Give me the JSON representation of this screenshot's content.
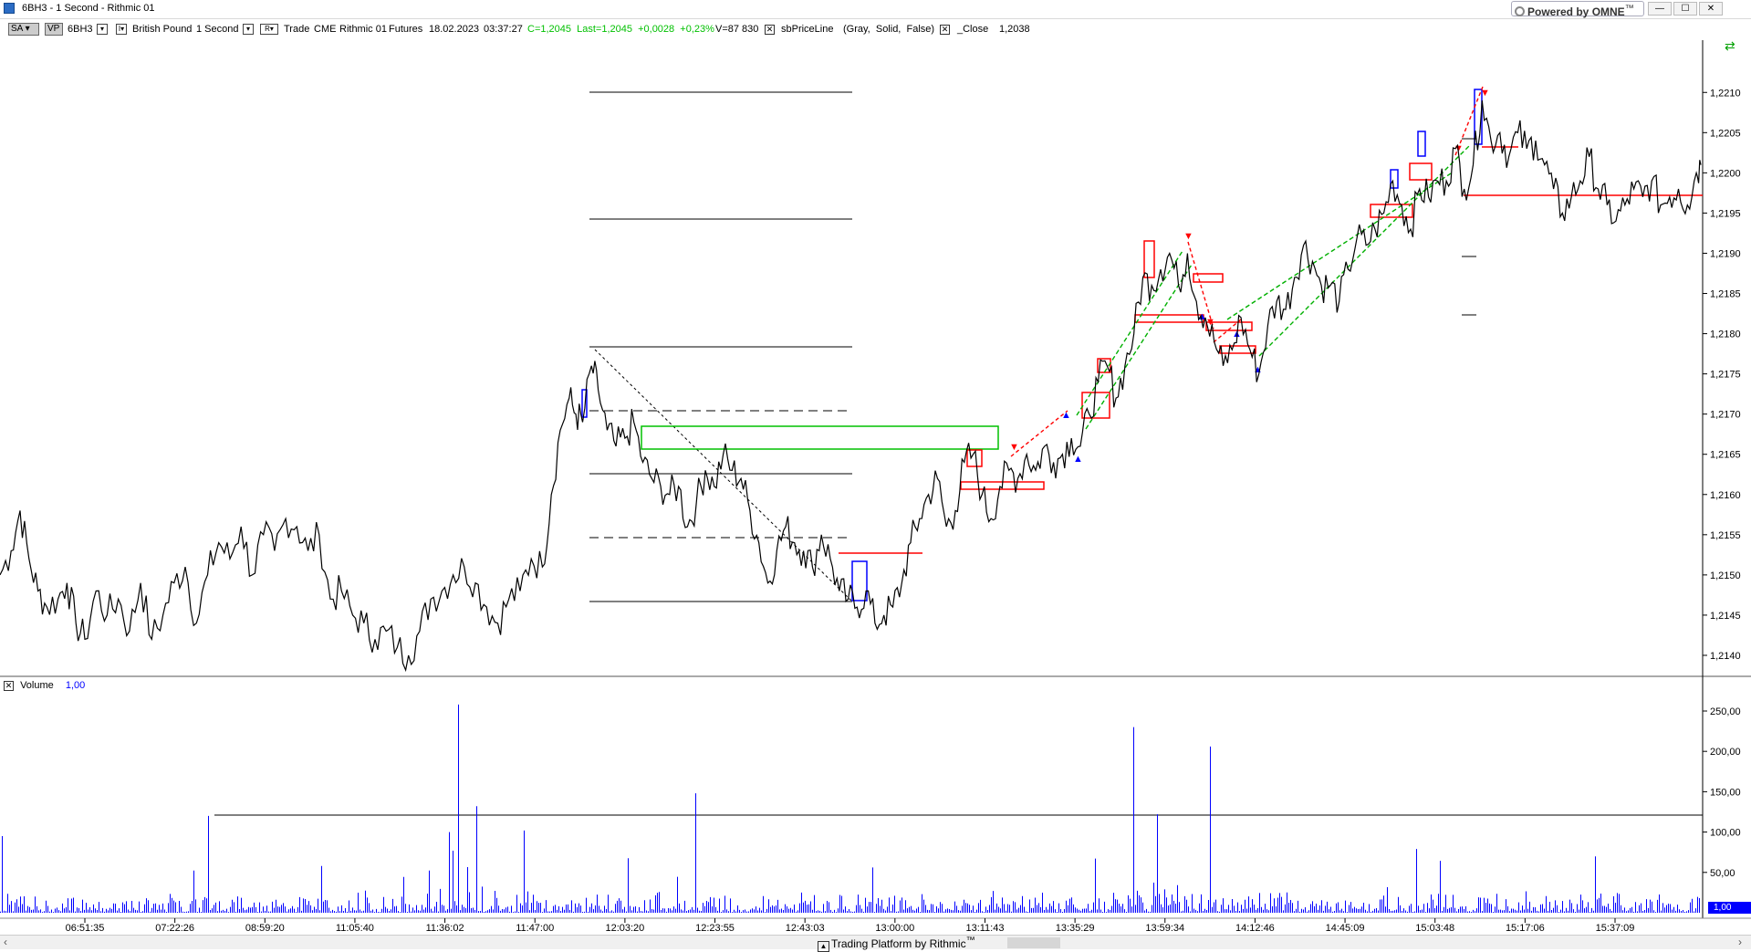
{
  "window": {
    "title": "6BH3 - 1 Second - Rithmic 01",
    "omne_label": "Powered by OMNE",
    "omne_tm": "™",
    "minimize": "—",
    "maximize": "☐",
    "close": "✕"
  },
  "toolbar": {
    "sa_label": "SA",
    "vp_label": "VP",
    "symbol": "6BH3",
    "instrument": "British Pound",
    "period": "1 Second",
    "r_label": "R",
    "mode": "Trade",
    "exchange": "CME",
    "connection": "Rithmic 01",
    "type": "Futures",
    "date": "18.02.2023",
    "time": "03:37:27",
    "quote": "C=1,2045  Last=1,2045  +0,0028  +0,23%",
    "volume": "V=87 830",
    "indicator": "sbPriceLine",
    "indicator_params": "(Gray,  Solid,  False)",
    "close_label": "_Close",
    "close_value": "1,2038"
  },
  "volume_panel": {
    "label": "Volume",
    "value": "1,00",
    "badge": "1,00"
  },
  "status": {
    "text": "Trading Platform by Rithmic",
    "tm": "™"
  },
  "colors": {
    "price": "#000000",
    "volume": "#0000ff",
    "zone_red": "#ff0000",
    "zone_green": "#00c000",
    "zone_blue": "#0000ff"
  },
  "chart_data": {
    "type": "line",
    "price_axis": {
      "ticks": [
        "1,2210",
        "1,2205",
        "1,2200",
        "1,2195",
        "1,2190",
        "1,2185",
        "1,2180",
        "1,2175",
        "1,2170",
        "1,2165",
        "1,2160",
        "1,2155",
        "1,2150",
        "1,2145",
        "1,2140"
      ],
      "ylim": [
        1.21375,
        1.22165
      ]
    },
    "volume_axis": {
      "ticks": [
        "250,00",
        "200,00",
        "150,00",
        "100,00",
        "50,00"
      ],
      "ylim": [
        0,
        276
      ]
    },
    "time_ticks": [
      "06:51:35",
      "07:22:26",
      "08:59:20",
      "11:05:40",
      "11:36:02",
      "11:47:00",
      "12:03:20",
      "12:23:55",
      "12:43:03",
      "13:00:00",
      "13:11:43",
      "13:35:29",
      "13:59:34",
      "14:12:46",
      "14:45:09",
      "15:03:48",
      "15:17:06",
      "15:37:09"
    ],
    "price_series": [
      [
        0,
        1.215
      ],
      [
        10,
        1.2153
      ],
      [
        18,
        1.2158
      ],
      [
        26,
        1.2152
      ],
      [
        34,
        1.2148
      ],
      [
        42,
        1.2146
      ],
      [
        52,
        1.2147
      ],
      [
        60,
        1.2149
      ],
      [
        68,
        1.2144
      ],
      [
        76,
        1.2142
      ],
      [
        86,
        1.2148
      ],
      [
        96,
        1.2145
      ],
      [
        106,
        1.2147
      ],
      [
        116,
        1.2143
      ],
      [
        126,
        1.2149
      ],
      [
        136,
        1.2142
      ],
      [
        146,
        1.2145
      ],
      [
        156,
        1.2149
      ],
      [
        166,
        1.2151
      ],
      [
        176,
        1.2144
      ],
      [
        186,
        1.215
      ],
      [
        196,
        1.2154
      ],
      [
        206,
        1.2152
      ],
      [
        216,
        1.2156
      ],
      [
        226,
        1.215
      ],
      [
        236,
        1.2155
      ],
      [
        246,
        1.2153
      ],
      [
        256,
        1.2157
      ],
      [
        266,
        1.2156
      ],
      [
        276,
        1.2153
      ],
      [
        286,
        1.2155
      ],
      [
        296,
        1.2147
      ],
      [
        306,
        1.2148
      ],
      [
        316,
        1.2145
      ],
      [
        326,
        1.2144
      ],
      [
        336,
        1.2142
      ],
      [
        346,
        1.2143
      ],
      [
        356,
        1.2141
      ],
      [
        366,
        1.214
      ],
      [
        376,
        1.2143
      ],
      [
        386,
        1.2147
      ],
      [
        396,
        1.2148
      ],
      [
        406,
        1.215
      ],
      [
        416,
        1.2151
      ],
      [
        426,
        1.2149
      ],
      [
        436,
        1.2146
      ],
      [
        446,
        1.2144
      ],
      [
        456,
        1.2147
      ],
      [
        466,
        1.2148
      ],
      [
        476,
        1.2152
      ],
      [
        486,
        1.2151
      ],
      [
        494,
        1.216
      ],
      [
        502,
        1.2168
      ],
      [
        510,
        1.2172
      ],
      [
        516,
        1.217
      ],
      [
        522,
        1.2169
      ],
      [
        530,
        1.2176
      ],
      [
        536,
        1.2173
      ],
      [
        544,
        1.2168
      ],
      [
        552,
        1.2166
      ],
      [
        560,
        1.2167
      ],
      [
        568,
        1.2169
      ],
      [
        576,
        1.2164
      ],
      [
        584,
        1.2162
      ],
      [
        592,
        1.2161
      ],
      [
        600,
        1.216
      ],
      [
        608,
        1.2161
      ],
      [
        616,
        1.2156
      ],
      [
        624,
        1.2159
      ],
      [
        632,
        1.2163
      ],
      [
        640,
        1.2161
      ],
      [
        648,
        1.2165
      ],
      [
        656,
        1.2163
      ],
      [
        664,
        1.2162
      ],
      [
        672,
        1.2158
      ],
      [
        680,
        1.2154
      ],
      [
        688,
        1.2149
      ],
      [
        696,
        1.2153
      ],
      [
        704,
        1.2156
      ],
      [
        712,
        1.2154
      ],
      [
        720,
        1.2153
      ],
      [
        728,
        1.2151
      ],
      [
        736,
        1.2155
      ],
      [
        744,
        1.2152
      ],
      [
        752,
        1.2148
      ],
      [
        760,
        1.2147
      ],
      [
        768,
        1.2146
      ],
      [
        776,
        1.2148
      ],
      [
        784,
        1.2144
      ],
      [
        792,
        1.2145
      ],
      [
        800,
        1.2146
      ],
      [
        808,
        1.2149
      ],
      [
        816,
        1.2154
      ],
      [
        824,
        1.2157
      ],
      [
        832,
        1.216
      ],
      [
        840,
        1.2162
      ],
      [
        848,
        1.2156
      ],
      [
        856,
        1.2158
      ],
      [
        864,
        1.2164
      ],
      [
        872,
        1.2165
      ],
      [
        880,
        1.216
      ],
      [
        888,
        1.2157
      ],
      [
        896,
        1.2161
      ],
      [
        904,
        1.2163
      ],
      [
        912,
        1.2162
      ],
      [
        920,
        1.2165
      ],
      [
        928,
        1.2163
      ],
      [
        936,
        1.2166
      ],
      [
        944,
        1.2164
      ],
      [
        952,
        1.2165
      ],
      [
        960,
        1.2167
      ],
      [
        968,
        1.2166
      ],
      [
        976,
        1.217
      ],
      [
        984,
        1.2174
      ],
      [
        992,
        1.2176
      ],
      [
        1000,
        1.2172
      ],
      [
        1008,
        1.2176
      ],
      [
        1016,
        1.218
      ],
      [
        1024,
        1.2187
      ],
      [
        1032,
        1.2186
      ],
      [
        1040,
        1.2188
      ],
      [
        1048,
        1.219
      ],
      [
        1056,
        1.2186
      ],
      [
        1064,
        1.219
      ],
      [
        1072,
        1.2184
      ],
      [
        1080,
        1.2182
      ],
      [
        1088,
        1.2179
      ],
      [
        1096,
        1.2176
      ],
      [
        1104,
        1.2178
      ],
      [
        1112,
        1.2182
      ],
      [
        1120,
        1.2178
      ],
      [
        1128,
        1.2175
      ],
      [
        1136,
        1.2181
      ],
      [
        1144,
        1.2184
      ],
      [
        1152,
        1.2183
      ],
      [
        1160,
        1.2187
      ],
      [
        1168,
        1.2191
      ],
      [
        1176,
        1.2189
      ],
      [
        1184,
        1.2186
      ],
      [
        1192,
        1.2186
      ],
      [
        1200,
        1.2184
      ],
      [
        1208,
        1.2188
      ],
      [
        1216,
        1.2192
      ],
      [
        1224,
        1.2191
      ],
      [
        1232,
        1.2193
      ],
      [
        1240,
        1.2195
      ],
      [
        1248,
        1.2199
      ],
      [
        1256,
        1.2196
      ],
      [
        1264,
        1.2193
      ],
      [
        1272,
        1.2198
      ],
      [
        1280,
        1.2197
      ],
      [
        1288,
        1.2199
      ],
      [
        1296,
        1.2199
      ],
      [
        1304,
        1.2203
      ],
      [
        1312,
        1.2198
      ],
      [
        1320,
        1.2201
      ],
      [
        1328,
        1.2209
      ],
      [
        1336,
        1.2204
      ],
      [
        1344,
        1.2205
      ],
      [
        1352,
        1.2202
      ],
      [
        1360,
        1.2205
      ],
      [
        1368,
        1.2203
      ],
      [
        1376,
        1.2204
      ],
      [
        1384,
        1.2201
      ],
      [
        1392,
        1.2198
      ],
      [
        1400,
        1.2195
      ],
      [
        1408,
        1.2197
      ],
      [
        1416,
        1.2199
      ],
      [
        1424,
        1.2202
      ],
      [
        1432,
        1.2198
      ],
      [
        1440,
        1.2196
      ],
      [
        1448,
        1.2194
      ],
      [
        1456,
        1.2196
      ],
      [
        1464,
        1.2198
      ],
      [
        1472,
        1.2197
      ],
      [
        1480,
        1.2199
      ],
      [
        1488,
        1.2196
      ],
      [
        1496,
        1.2197
      ],
      [
        1504,
        1.2198
      ],
      [
        1512,
        1.2196
      ],
      [
        1520,
        1.22
      ],
      [
        1524,
        1.2201
      ]
    ],
    "volume_spikes": [
      [
        2,
        95
      ],
      [
        228,
        120
      ],
      [
        492,
        100
      ],
      [
        502,
        258
      ],
      [
        522,
        132
      ],
      [
        574,
        102
      ],
      [
        763,
        148
      ],
      [
        1243,
        230
      ],
      [
        1269,
        122
      ],
      [
        1327,
        206
      ]
    ]
  }
}
